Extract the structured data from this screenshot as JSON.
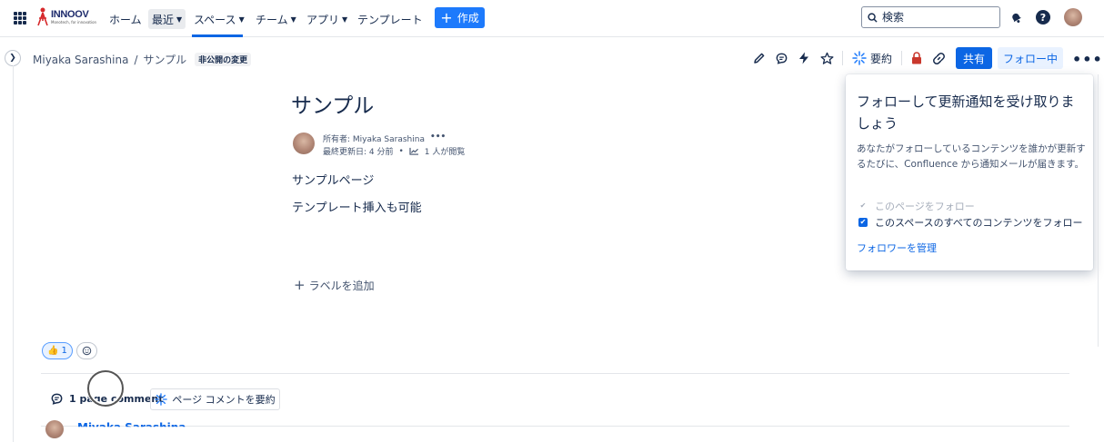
{
  "topnav": {
    "logo_text": "INNOOV",
    "logo_sub": "Monotech, for innovation",
    "items": [
      {
        "label": "ホーム",
        "dropdown": false
      },
      {
        "label": "最近",
        "dropdown": true
      },
      {
        "label": "スペース",
        "dropdown": true
      },
      {
        "label": "チーム",
        "dropdown": true
      },
      {
        "label": "アプリ",
        "dropdown": true
      },
      {
        "label": "テンプレート",
        "dropdown": false
      }
    ],
    "create_label": "作成",
    "search_placeholder": "検索",
    "help_label": "?"
  },
  "breadcrumb": {
    "space": "Miyaka Sarashina",
    "separator": "/",
    "page": "サンプル",
    "badge": "非公開の変更"
  },
  "toolbar": {
    "summary_label": "要約",
    "share_label": "共有",
    "follow_label": "フォロー中",
    "more_label": "•••"
  },
  "page": {
    "title": "サンプル",
    "owner_label": "所有者: Miyaka Sarashina",
    "owner_more": "•••",
    "updated_label": "最終更新日: 4 分前",
    "dot": "•",
    "views_label": "1 人が閲覧",
    "paragraphs": [
      "サンプルページ",
      "テンプレート挿入も可能"
    ],
    "add_label": "ラベルを追加"
  },
  "reactions": {
    "thumbs_count": "1"
  },
  "comments": {
    "count_label": "1 page comment",
    "summary_button": "ページ コメントを要約",
    "first_author": "Miyaka Sarashina"
  },
  "popup": {
    "title": "フォローして更新通知を受け取りましょう",
    "description": "あなたがフォローしているコンテンツを誰かが更新するたびに、Confluence から通知メールが届きます。",
    "check_page": "このページをフォロー",
    "check_space": "このスペースのすべてのコンテンツをフォロー",
    "manage_link": "フォロワーを管理"
  },
  "colors": {
    "primary": "#0c66e4",
    "create_button": "#1d7afc",
    "follow_bg": "#e9f2ff",
    "restriction_lock": "#c9372c",
    "text": "#172b4d"
  }
}
